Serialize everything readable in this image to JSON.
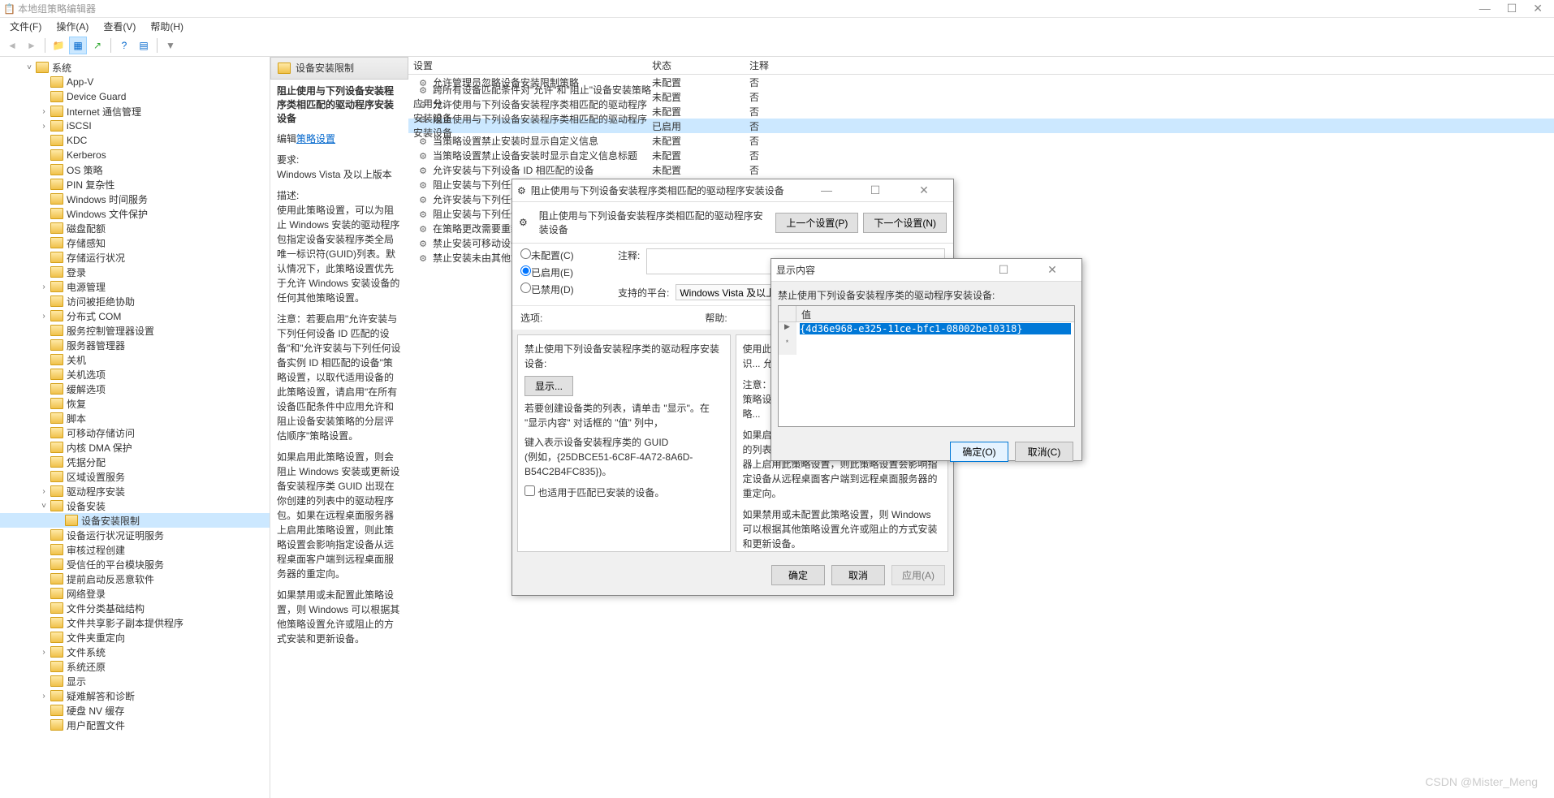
{
  "app_title": "本地组策略编辑器",
  "menu": {
    "file": "文件(F)",
    "action": "操作(A)",
    "view": "查看(V)",
    "help": "帮助(H)"
  },
  "tree": {
    "root": "系统",
    "items": [
      "App-V",
      "Device Guard",
      "Internet 通信管理",
      "iSCSI",
      "KDC",
      "Kerberos",
      "OS 策略",
      "PIN 复杂性",
      "Windows 时间服务",
      "Windows 文件保护",
      "磁盘配额",
      "存储感知",
      "存储运行状况",
      "登录",
      "电源管理",
      "访问被拒绝协助",
      "分布式 COM",
      "服务控制管理器设置",
      "服务器管理器",
      "关机",
      "关机选项",
      "缓解选项",
      "恢复",
      "脚本",
      "可移动存储访问",
      "内核 DMA 保护",
      "凭据分配",
      "区域设置服务",
      "驱动程序安装"
    ],
    "device_install": "设备安装",
    "selected": "设备安装限制",
    "device_items": [
      "设备运行状况证明服务",
      "审核过程创建",
      "受信任的平台模块服务",
      "提前启动反恶意软件",
      "网络登录",
      "文件分类基础结构",
      "文件共享影子副本提供程序",
      "文件夹重定向",
      "文件系统",
      "系统还原",
      "显示",
      "疑难解答和诊断",
      "硬盘 NV 缓存",
      "用户配置文件"
    ]
  },
  "folder_header": "设备安装限制",
  "desc": {
    "title": "阻止使用与下列设备安装程序类相匹配的驱动程序安装设备",
    "edit_link_prefix": "编辑",
    "edit_link": "策略设置",
    "req_label": "要求:",
    "req_value": "Windows Vista 及以上版本",
    "desc_label": "描述:",
    "p1": "使用此策略设置，可以为阻止 Windows 安装的驱动程序包指定设备安装程序类全局唯一标识符(GUID)列表。默认情况下，此策略设置优先于允许 Windows 安装设备的任何其他策略设置。",
    "p2": "注意：若要启用\"允许安装与下列任何设备 ID 匹配的设备\"和\"允许安装与下列任何设备实例 ID 相匹配的设备\"策略设置，以取代适用设备的此策略设置，请启用\"在所有设备匹配条件中应用允许和阻止设备安装策略的分层评估顺序\"策略设置。",
    "p3": "如果启用此策略设置，则会阻止 Windows 安装或更新设备安装程序类 GUID 出现在你创建的列表中的驱动程序包。如果在远程桌面服务器上启用此策略设置，则此策略设置会影响指定设备从远程桌面客户端到远程桌面服务器的重定向。",
    "p4": "如果禁用或未配置此策略设置，则 Windows 可以根据其他策略设置允许或阻止的方式安装和更新设备。"
  },
  "columns": {
    "setting": "设置",
    "state": "状态",
    "comment": "注释"
  },
  "settings_rows": [
    {
      "name": "允许管理员忽略设备安装限制策略",
      "state": "未配置",
      "comment": "否"
    },
    {
      "name": "跨所有设备匹配条件对\"允许\"和\"阻止\"设备安装策略应用分...",
      "state": "未配置",
      "comment": "否"
    },
    {
      "name": "允许使用与下列设备安装程序类相匹配的驱动程序安装设备",
      "state": "未配置",
      "comment": "否"
    },
    {
      "name": "阻止使用与下列设备安装程序类相匹配的驱动程序安装设备",
      "state": "已启用",
      "comment": "否",
      "selected": true
    },
    {
      "name": "当策略设置禁止安装时显示自定义信息",
      "state": "未配置",
      "comment": "否"
    },
    {
      "name": "当策略设置禁止设备安装时显示自定义信息标题",
      "state": "未配置",
      "comment": "否"
    },
    {
      "name": "允许安装与下列设备 ID 相匹配的设备",
      "state": "未配置",
      "comment": "否"
    },
    {
      "name": "阻止安装与下列任何设备 ...",
      "state": "",
      "comment": ""
    },
    {
      "name": "允许安装与下列任何设备...",
      "state": "",
      "comment": ""
    },
    {
      "name": "阻止安装与下列任何设备...",
      "state": "",
      "comment": ""
    },
    {
      "name": "在策略更改需要重新启动...",
      "state": "",
      "comment": ""
    },
    {
      "name": "禁止安装可移动设备",
      "state": "",
      "comment": ""
    },
    {
      "name": "禁止安装未由其他策略设置...",
      "state": "",
      "comment": ""
    }
  ],
  "policy_dlg": {
    "title": "阻止使用与下列设备安装程序类相匹配的驱动程序安装设备",
    "heading": "阻止使用与下列设备安装程序类相匹配的驱动程序安装设备",
    "prev": "上一个设置(P)",
    "next": "下一个设置(N)",
    "not_configured": "未配置(C)",
    "enabled": "已启用(E)",
    "disabled": "已禁用(D)",
    "note_label": "注释:",
    "platform_label": "支持的平台:",
    "platform_value": "Windows Vista 及以上版本",
    "options_label": "选项:",
    "help_label": "帮助:",
    "options_text": "禁止使用下列设备安装程序类的驱动程序安装设备:",
    "show_btn": "显示...",
    "options_hint": "若要创建设备类的列表，请单击 \"显示\"。在 \"显示内容\" 对话框的 \"值\" 列中，",
    "options_hint2": "键入表示设备安装程序类的 GUID",
    "options_example": "(例如，{25DBCE51-6C8F-4A72-8A6D-B54C2B4FC835})。",
    "options_check": "也适用于匹配已安装的设备。",
    "help_text1": "使用此策略设置，可以... 程序类全局唯一标识... 允许 Windows 安装设...",
    "help_text2": "注意：若要启用\"允许... 与下列任何设备实例... 策略设置，请启用\"在... 的分层评估顺序\"策略...",
    "help_text3": "如果启用此策略设置，... GUID 出现在你创建的列表中的驱动程序包。如果在远程桌面服务器上启用此策略设置，则此策略设置会影响指定设备从远程桌面客户端到远程桌面服务器的重定向。",
    "help_text4": "如果禁用或未配置此策略设置，则 Windows 可以根据其他策略设置允许或阻止的方式安装和更新设备。",
    "ok": "确定",
    "cancel": "取消",
    "apply": "应用(A)"
  },
  "show_dlg": {
    "title": "显示内容",
    "label": "禁止使用下列设备安装程序类的驱动程序安装设备:",
    "col": "值",
    "value": "{4d36e968-e325-11ce-bfc1-08002be10318}",
    "ok": "确定(O)",
    "cancel": "取消(C)"
  },
  "watermark": "CSDN @Mister_Meng"
}
